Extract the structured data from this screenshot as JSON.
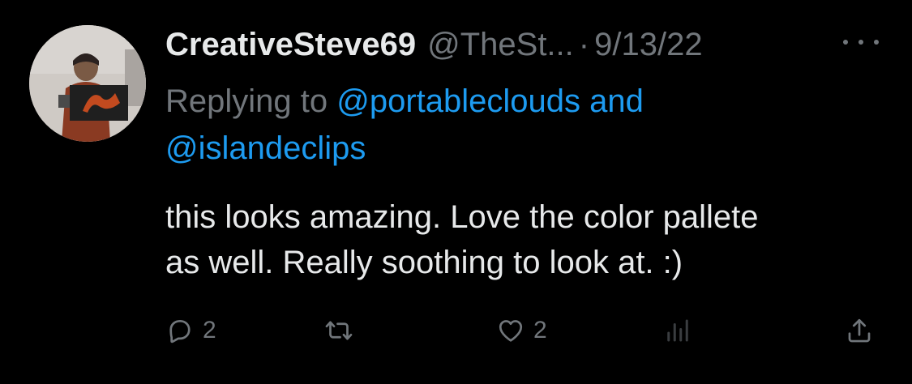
{
  "tweet": {
    "display_name": "CreativeSteve69",
    "handle": "@TheSt...",
    "separator": "·",
    "timestamp": "9/13/22",
    "replying_to_prefix": "Replying to ",
    "mention_1": "@portableclouds",
    "joiner": " and",
    "mention_2": "@islandeclips",
    "text_line_1": "this looks amazing. Love the color pallete",
    "text_line_2": "as well. Really soothing to look at. :)"
  },
  "actions": {
    "reply": {
      "icon": "reply-icon",
      "count": "2"
    },
    "retweet": {
      "icon": "retweet-icon"
    },
    "like": {
      "icon": "heart-icon",
      "count": "2"
    },
    "views": {
      "icon": "views-icon"
    },
    "share": {
      "icon": "share-icon"
    }
  },
  "colors": {
    "background": "#000000",
    "primary_text": "#e7e9ea",
    "secondary_text": "#71767b",
    "link": "#1d9bf0"
  }
}
